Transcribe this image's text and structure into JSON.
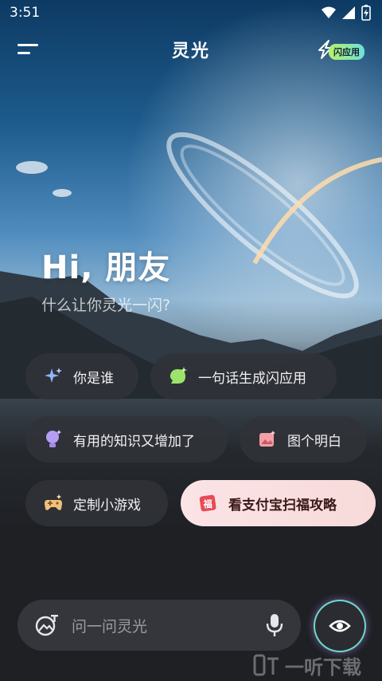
{
  "status": {
    "time": "3:51"
  },
  "header": {
    "title": "灵光",
    "flash_badge": "闪应用"
  },
  "greeting": {
    "title": "Hi, 朋友",
    "subtitle": "什么让你灵光一闪?"
  },
  "chips": [
    {
      "label": "你是谁",
      "icon": "sparkle-icon"
    },
    {
      "label": "一句话生成闪应用",
      "icon": "chat-bubble-icon"
    },
    {
      "label": "有用的知识又增加了",
      "icon": "lightbulb-icon"
    },
    {
      "label": "图个明白",
      "icon": "image-sparkle-icon"
    },
    {
      "label": "定制小游戏",
      "icon": "gamepad-icon"
    },
    {
      "label": "看支付宝扫福攻略",
      "icon": "fu-card-icon"
    }
  ],
  "fu_char": "福",
  "input": {
    "placeholder": "问一问灵光"
  },
  "watermark": {
    "text": "一听下载"
  },
  "colors": {
    "accent_green": "#9be36a",
    "promo_bg": "#fbe4e6",
    "chip_bg": "#303238"
  }
}
